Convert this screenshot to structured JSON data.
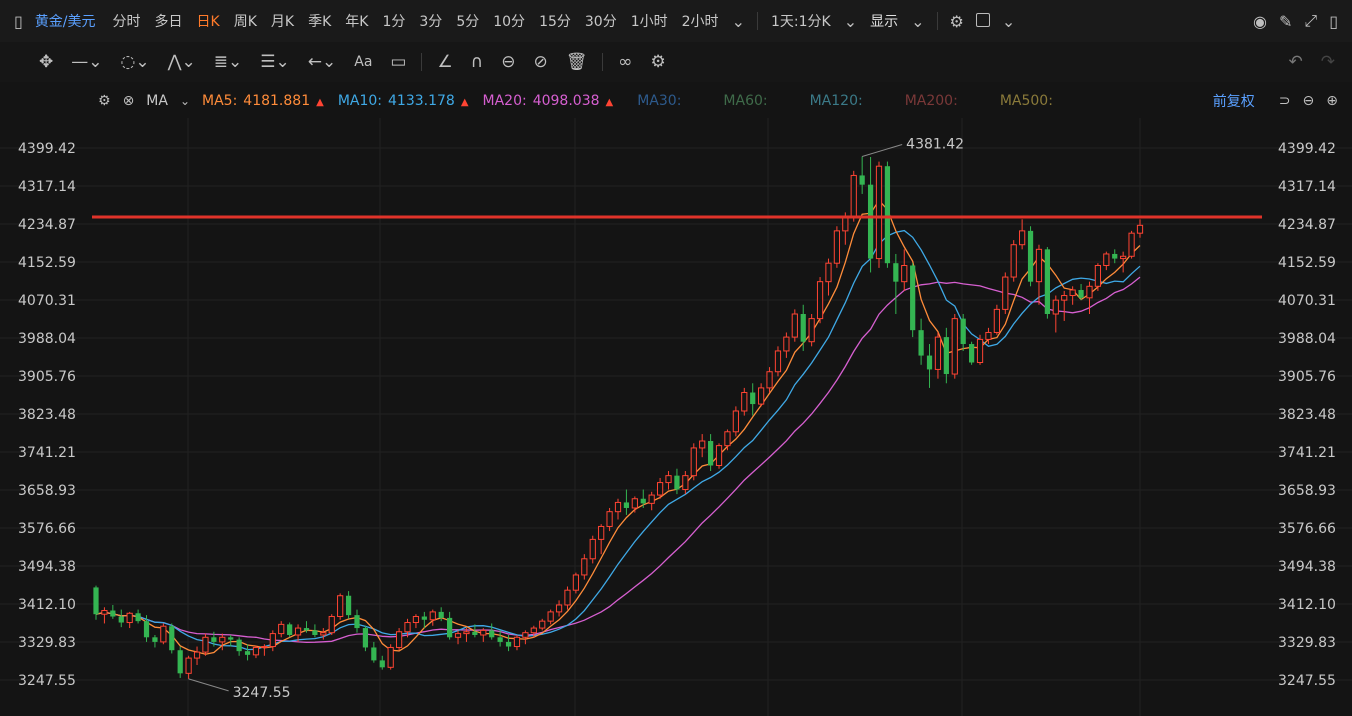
{
  "header": {
    "symbol": "黄金/美元",
    "timeframes": [
      "分时",
      "多日",
      "日K",
      "周K",
      "月K",
      "季K",
      "年K",
      "1分",
      "3分",
      "5分",
      "10分",
      "15分",
      "30分",
      "1小时",
      "2小时"
    ],
    "active_timeframe": "日K",
    "dropdown_sync": "1天:1分K",
    "display_label": "显示"
  },
  "toolbar": {
    "text_tool": "Aa",
    "undo_icon": "undo-icon",
    "redo_icon": "redo-icon"
  },
  "indicator": {
    "name": "MA",
    "ma": [
      {
        "label": "MA5:",
        "value": "4181.881",
        "color": "#ff8c3a",
        "trend": "▲"
      },
      {
        "label": "MA10:",
        "value": "4133.178",
        "color": "#3fa9e6",
        "trend": "▲"
      },
      {
        "label": "MA20:",
        "value": "4098.038",
        "color": "#d65fd0",
        "trend": "▲"
      },
      {
        "label": "MA30:",
        "value": "",
        "color": "#2d5a8c",
        "trend": ""
      },
      {
        "label": "MA60:",
        "value": "",
        "color": "#3f6b4a",
        "trend": ""
      },
      {
        "label": "MA120:",
        "value": "",
        "color": "#3b7a88",
        "trend": ""
      },
      {
        "label": "MA200:",
        "value": "",
        "color": "#7a3838",
        "trend": ""
      },
      {
        "label": "MA500:",
        "value": "",
        "color": "#8a7a3a",
        "trend": ""
      }
    ],
    "adjust_label": "前复权"
  },
  "colors": {
    "up": "#ff4433",
    "down": "#34b552",
    "hline": "#e0332a",
    "background": "#141414"
  },
  "chart_data": {
    "type": "candlestick",
    "y_ticks": [
      "4399.42",
      "4317.14",
      "4234.87",
      "4152.59",
      "4070.31",
      "3988.04",
      "3905.76",
      "3823.48",
      "3741.21",
      "3658.93",
      "3576.66",
      "3494.38",
      "3412.10",
      "3329.83",
      "3247.55"
    ],
    "ylim": [
      3215,
      4435
    ],
    "horizontal_line": 4250,
    "annotations": {
      "high": "4381.42",
      "low": "3247.55"
    },
    "candles": [
      [
        3448,
        3452,
        3378,
        3390
      ],
      [
        3390,
        3405,
        3370,
        3398
      ],
      [
        3398,
        3410,
        3380,
        3385
      ],
      [
        3385,
        3400,
        3362,
        3372
      ],
      [
        3372,
        3395,
        3360,
        3392
      ],
      [
        3392,
        3400,
        3370,
        3375
      ],
      [
        3375,
        3388,
        3330,
        3340
      ],
      [
        3340,
        3345,
        3318,
        3330
      ],
      [
        3330,
        3370,
        3325,
        3364
      ],
      [
        3364,
        3370,
        3305,
        3312
      ],
      [
        3312,
        3320,
        3252,
        3262
      ],
      [
        3262,
        3300,
        3250,
        3295
      ],
      [
        3295,
        3320,
        3280,
        3308
      ],
      [
        3308,
        3348,
        3300,
        3340
      ],
      [
        3340,
        3352,
        3320,
        3330
      ],
      [
        3330,
        3348,
        3312,
        3340
      ],
      [
        3340,
        3345,
        3320,
        3335
      ],
      [
        3335,
        3340,
        3300,
        3310
      ],
      [
        3310,
        3325,
        3290,
        3302
      ],
      [
        3302,
        3322,
        3295,
        3318
      ],
      [
        3318,
        3325,
        3300,
        3320
      ],
      [
        3320,
        3355,
        3310,
        3348
      ],
      [
        3348,
        3375,
        3340,
        3368
      ],
      [
        3368,
        3372,
        3340,
        3345
      ],
      [
        3345,
        3368,
        3330,
        3360
      ],
      [
        3360,
        3375,
        3350,
        3355
      ],
      [
        3355,
        3368,
        3340,
        3345
      ],
      [
        3345,
        3360,
        3335,
        3350
      ],
      [
        3350,
        3390,
        3345,
        3385
      ],
      [
        3385,
        3435,
        3378,
        3430
      ],
      [
        3430,
        3440,
        3380,
        3388
      ],
      [
        3388,
        3400,
        3350,
        3360
      ],
      [
        3360,
        3365,
        3310,
        3318
      ],
      [
        3318,
        3330,
        3285,
        3290
      ],
      [
        3290,
        3300,
        3270,
        3275
      ],
      [
        3275,
        3325,
        3270,
        3318
      ],
      [
        3318,
        3360,
        3312,
        3352
      ],
      [
        3352,
        3380,
        3340,
        3372
      ],
      [
        3372,
        3390,
        3360,
        3385
      ],
      [
        3385,
        3395,
        3360,
        3378
      ],
      [
        3378,
        3400,
        3365,
        3395
      ],
      [
        3395,
        3405,
        3375,
        3382
      ],
      [
        3382,
        3395,
        3335,
        3340
      ],
      [
        3340,
        3355,
        3325,
        3348
      ],
      [
        3348,
        3360,
        3330,
        3352
      ],
      [
        3352,
        3368,
        3340,
        3345
      ],
      [
        3345,
        3360,
        3330,
        3355
      ],
      [
        3355,
        3370,
        3335,
        3340
      ],
      [
        3340,
        3355,
        3320,
        3330
      ],
      [
        3330,
        3345,
        3310,
        3320
      ],
      [
        3320,
        3345,
        3312,
        3340
      ],
      [
        3340,
        3355,
        3325,
        3350
      ],
      [
        3350,
        3365,
        3340,
        3360
      ],
      [
        3360,
        3380,
        3355,
        3375
      ],
      [
        3375,
        3400,
        3368,
        3395
      ],
      [
        3395,
        3420,
        3385,
        3410
      ],
      [
        3410,
        3450,
        3400,
        3442
      ],
      [
        3442,
        3480,
        3435,
        3475
      ],
      [
        3475,
        3520,
        3465,
        3510
      ],
      [
        3510,
        3560,
        3500,
        3552
      ],
      [
        3552,
        3585,
        3520,
        3580
      ],
      [
        3580,
        3620,
        3570,
        3612
      ],
      [
        3612,
        3640,
        3595,
        3632
      ],
      [
        3632,
        3660,
        3605,
        3620
      ],
      [
        3620,
        3645,
        3610,
        3640
      ],
      [
        3640,
        3660,
        3620,
        3630
      ],
      [
        3630,
        3655,
        3615,
        3648
      ],
      [
        3648,
        3685,
        3640,
        3675
      ],
      [
        3675,
        3700,
        3660,
        3690
      ],
      [
        3690,
        3705,
        3650,
        3660
      ],
      [
        3660,
        3700,
        3650,
        3690
      ],
      [
        3690,
        3760,
        3680,
        3750
      ],
      [
        3750,
        3780,
        3730,
        3765
      ],
      [
        3765,
        3780,
        3700,
        3712
      ],
      [
        3712,
        3760,
        3705,
        3755
      ],
      [
        3755,
        3790,
        3745,
        3785
      ],
      [
        3785,
        3840,
        3775,
        3830
      ],
      [
        3830,
        3880,
        3820,
        3870
      ],
      [
        3870,
        3890,
        3820,
        3845
      ],
      [
        3845,
        3890,
        3840,
        3880
      ],
      [
        3880,
        3925,
        3870,
        3915
      ],
      [
        3915,
        3970,
        3905,
        3960
      ],
      [
        3960,
        4000,
        3945,
        3990
      ],
      [
        3990,
        4050,
        3980,
        4040
      ],
      [
        4040,
        4060,
        3960,
        3980
      ],
      [
        3980,
        4040,
        3970,
        4030
      ],
      [
        4030,
        4120,
        4020,
        4110
      ],
      [
        4110,
        4160,
        4080,
        4150
      ],
      [
        4150,
        4230,
        4140,
        4220
      ],
      [
        4220,
        4260,
        4190,
        4250
      ],
      [
        4250,
        4350,
        4240,
        4340
      ],
      [
        4340,
        4381,
        4300,
        4320
      ],
      [
        4320,
        4380,
        4130,
        4160
      ],
      [
        4160,
        4370,
        4140,
        4360
      ],
      [
        4360,
        4370,
        4140,
        4150
      ],
      [
        4150,
        4170,
        4040,
        4110
      ],
      [
        4110,
        4180,
        4090,
        4145
      ],
      [
        4145,
        4150,
        3990,
        4005
      ],
      [
        4005,
        4030,
        3930,
        3950
      ],
      [
        3950,
        3975,
        3880,
        3920
      ],
      [
        3920,
        4000,
        3900,
        3990
      ],
      [
        3990,
        4010,
        3890,
        3910
      ],
      [
        3910,
        4040,
        3900,
        4030
      ],
      [
        4030,
        4040,
        3960,
        3975
      ],
      [
        3975,
        3980,
        3930,
        3935
      ],
      [
        3935,
        3995,
        3930,
        3985
      ],
      [
        3985,
        4010,
        3975,
        4000
      ],
      [
        4000,
        4060,
        3995,
        4050
      ],
      [
        4050,
        4130,
        4040,
        4120
      ],
      [
        4120,
        4200,
        4110,
        4190
      ],
      [
        4190,
        4245,
        4180,
        4220
      ],
      [
        4220,
        4230,
        4100,
        4110
      ],
      [
        4110,
        4190,
        4060,
        4180
      ],
      [
        4180,
        4185,
        4030,
        4040
      ],
      [
        4040,
        4080,
        4000,
        4070
      ],
      [
        4070,
        4090,
        4025,
        4080
      ],
      [
        4080,
        4100,
        4060,
        4092
      ],
      [
        4092,
        4105,
        4070,
        4075
      ],
      [
        4075,
        4110,
        4040,
        4100
      ],
      [
        4100,
        4150,
        4090,
        4145
      ],
      [
        4145,
        4175,
        4135,
        4170
      ],
      [
        4170,
        4180,
        4150,
        4160
      ],
      [
        4160,
        4175,
        4130,
        4165
      ],
      [
        4165,
        4220,
        4160,
        4215
      ],
      [
        4215,
        4245,
        4205,
        4232
      ]
    ]
  }
}
